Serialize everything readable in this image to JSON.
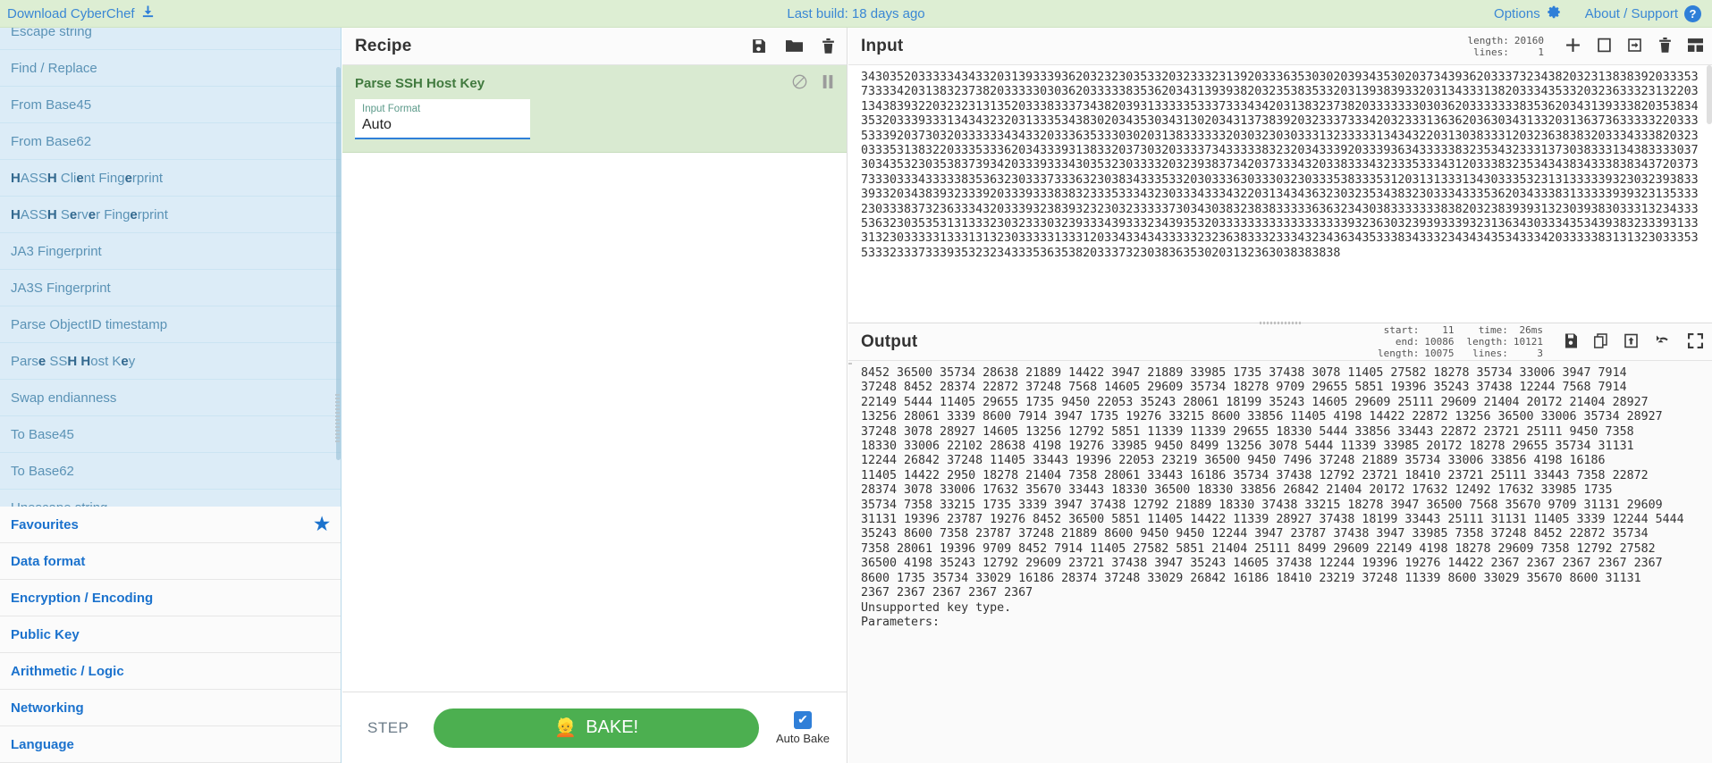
{
  "banner": {
    "download_label": "Download CyberChef",
    "download_icon": "download-icon",
    "last_build": "Last build: 18 days ago",
    "options_label": "Options",
    "options_icon": "gear-icon",
    "about_label": "About / Support",
    "about_icon": "question-circle-icon"
  },
  "sidebar": {
    "operations": [
      {
        "label": "Escape string",
        "bold": ""
      },
      {
        "label": "Find / Replace",
        "bold": ""
      },
      {
        "label": "From Base45",
        "bold": ""
      },
      {
        "label": "From Base62",
        "bold": ""
      },
      {
        "label": "HASSH Client Fingerprint",
        "bold": "H,e"
      },
      {
        "label": "HASSH Server Fingerprint",
        "bold": "H,e"
      },
      {
        "label": "JA3 Fingerprint",
        "bold": ""
      },
      {
        "label": "JA3S Fingerprint",
        "bold": ""
      },
      {
        "label": "Parse ObjectID timestamp",
        "bold": ""
      },
      {
        "label": "Parse SSH Host Key",
        "bold": "H,e"
      },
      {
        "label": "Swap endianness",
        "bold": ""
      },
      {
        "label": "To Base45",
        "bold": ""
      },
      {
        "label": "To Base62",
        "bold": ""
      },
      {
        "label": "Unescape string",
        "bold": ""
      }
    ],
    "categories": [
      {
        "label": "Favourites",
        "icon": "star-icon"
      },
      {
        "label": "Data format",
        "icon": ""
      },
      {
        "label": "Encryption / Encoding",
        "icon": ""
      },
      {
        "label": "Public Key",
        "icon": ""
      },
      {
        "label": "Arithmetic / Logic",
        "icon": ""
      },
      {
        "label": "Networking",
        "icon": ""
      },
      {
        "label": "Language",
        "icon": ""
      }
    ]
  },
  "recipe": {
    "title": "Recipe",
    "icons": [
      "save-icon",
      "folder-open-icon",
      "trash-icon"
    ],
    "operation": {
      "name": "Parse SSH Host Key",
      "disable_icon": "disable-circle-slash-icon",
      "breakpoint_icon": "pause-breakpoint-icon",
      "arg_label": "Input Format",
      "arg_value": "Auto"
    },
    "footer": {
      "step_label": "STEP",
      "bake_label": "BAKE!",
      "bake_icon": "chef-emoji",
      "auto_bake_label": "Auto Bake",
      "auto_bake_checked": true,
      "bake_color": "#4caf50"
    }
  },
  "input": {
    "title": "Input",
    "stats": {
      "length_key": "length:",
      "length_val": "20160",
      "lines_key": "lines:",
      "lines_val": "1"
    },
    "icons": [
      "plus-icon",
      "folder-open-icon",
      "open-folder-as-input-icon",
      "trash-icon",
      "tabs-grid-icon"
    ],
    "text": "3430352033333434332031393339362032323035332032333231392033363530302039343530203734393620333732343820323138383920333537333342031383237382033333030362033333835362034313939382032353835332031393839332031343331382033343533203236333231322031343839322032323131352033383337343820393133333533373334342031383237382033333330303620333333383536203431393338203538343532033393331343432320313335343830203435303431302034313738392032333733342032333136362036303431332031363736333332203335333920373032033333343433203336353330302031383333332030323030333132333331343432203130383331203236383832033343338203230333531383220333533362034333931383320373032033337343333383232034333920333936343333383235343233313730383331343833330373034353230353837393420333933343035323033332032393837342037333432033833343233353334312033383235343438343338383437203737333033343333383536323033373336323038343335332030333630333032303335383335312031313331343033353231313333393230323938333933203438393233392033393338383233353334323033343334322031343436323032353438323033343335362034333831333339393231353332303338373236333432033393238393232303233333730343038323838333336363234303833333338382032383939313230393830333132343335363230353531313332303233303239333439333234393532033333333333333333393236303239393339323136343033343534393832333931333132303333313331313230333331333120334334343333323236383332333432343634353338343332343434353433342033333831313230333535333233373339353232343335363538203337323038363530203132363038383838",
    "scroll_visible": true
  },
  "output": {
    "title": "Output",
    "stats": {
      "start_key": "start:",
      "start_val": "11",
      "end_key": "end:",
      "end_val": "10086",
      "sel_length_key": "length:",
      "sel_length_val": "10075",
      "time_key": "time:",
      "time_val": "26ms",
      "length_key": "length:",
      "length_val": "10121",
      "lines_key": "lines:",
      "lines_val": "3"
    },
    "icons": [
      "save-icon",
      "copy-icon",
      "bake-to-input-icon",
      "undo-icon",
      "maximize-icon"
    ],
    "lines": [
      "8452 36500 35734 28638 21889 14422 3947 21889 33985 1735 37438 3078 11405 27582 18278 35734 33006 3947 7914",
      "37248 8452 28374 22872 37248 7568 14605 29609 35734 18278 9709 29655 5851 19396 35243 37438 12244 7568 7914",
      "22149 5444 11405 29655 1735 9450 22053 35243 28061 18199 35243 14605 29609 25111 29609 21404 20172 21404 28927",
      "13256 28061 3339 8600 7914 3947 1735 19276 33215 8600 33856 11405 4198 14422 22872 13256 36500 33006 35734 28927",
      "37248 3078 28927 14605 13256 12792 5851 11339 11339 29655 18330 5444 33856 33443 22872 23721 25111 9450 7358",
      "18330 33006 22102 28638 4198 19276 33985 9450 8499 13256 3078 5444 11339 33985 20172 18278 29655 35734 31131",
      "12244 26842 37248 11405 33443 19396 22053 23219 36500 9450 7496 37248 21889 35734 33006 33856 4198 16186",
      "11405 14422 2950 18278 21404 7358 28061 33443 16186 35734 37438 12792 23721 18410 23721 25111 33443 7358 22872",
      "28374 3078 33006 17632 35670 33443 18330 36500 18330 33856 26842 21404 20172 17632 12492 17632 33985 1735",
      "35734 7358 33215 1735 3339 3947 37438 12792 21889 18330 37438 33215 18278 3947 36500 7568 35670 9709 31131 29609",
      "31131 19396 23787 19276 8452 36500 5851 11405 14422 11339 28927 37438 18199 33443 25111 31131 11405 3339 12244 5444",
      "35243 8600 7358 23787 37248 21889 8600 9450 9450 12244 3947 23787 37438 3947 33985 7358 37248 8452 22872 35734",
      "7358 28061 19396 9709 8452 7914 11405 27582 5851 21404 25111 8499 29609 22149 4198 18278 29609 7358 12792 27582",
      "36500 4198 35243 12792 29609 23721 37438 3947 35243 14605 37438 12244 19396 19276 14422 2367 2367 2367 2367 2367",
      "8600 1735 35734 33029 16186 28374 37248 33029 26842 16186 18410 23219 37248 11339 8600 33029 35670 8600 31131",
      "2367 2367 2367 2367 2367",
      "Unsupported key type.",
      "Parameters:"
    ]
  }
}
